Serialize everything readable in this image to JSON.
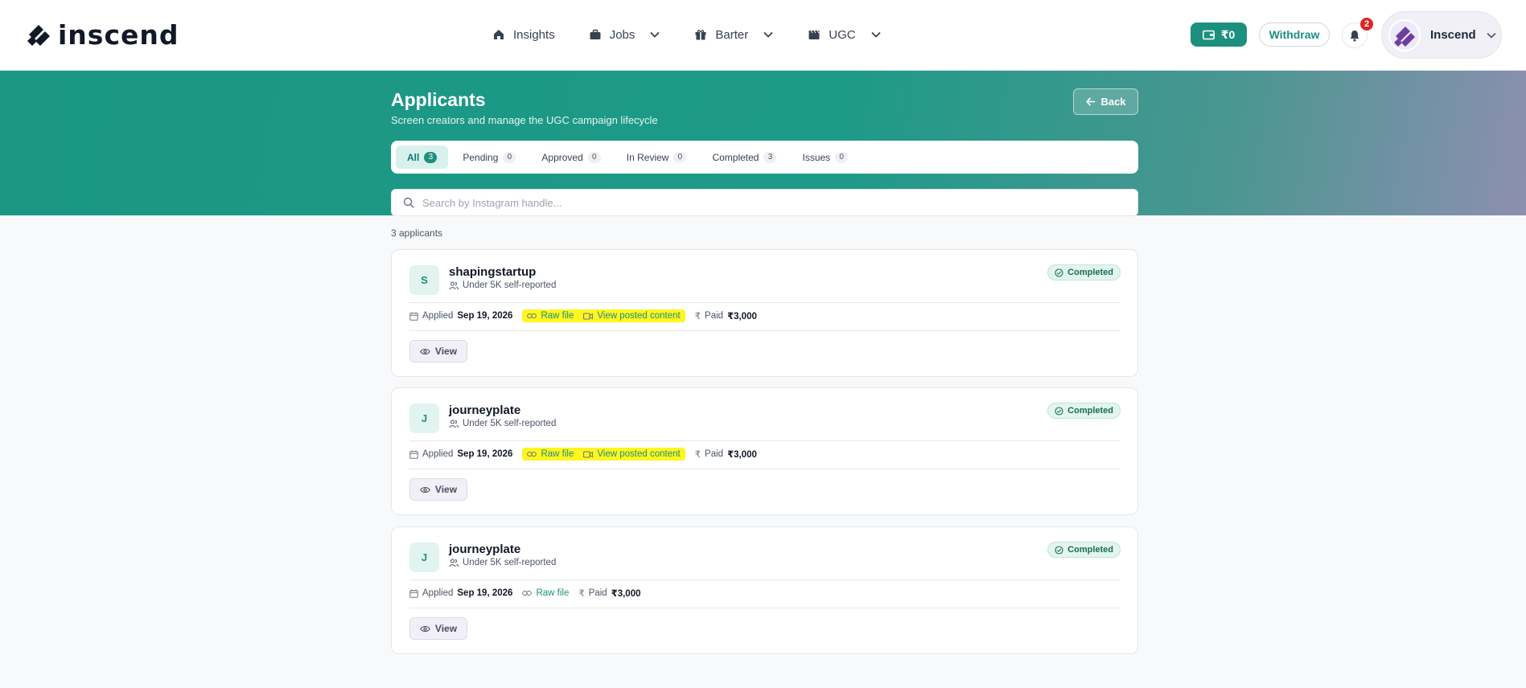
{
  "brand": {
    "name": "inscend"
  },
  "nav": {
    "items": [
      {
        "label": "Insights",
        "icon": "home-icon"
      },
      {
        "label": "Jobs",
        "icon": "briefcase-icon"
      },
      {
        "label": "Barter",
        "icon": "gift-icon"
      },
      {
        "label": "UGC",
        "icon": "clapperboard-icon"
      }
    ],
    "wallet_balance": "₹0",
    "withdraw_label": "Withdraw",
    "notification_count": "2",
    "profile_name": "Inscend"
  },
  "header": {
    "title": "Applicants",
    "subtitle": "Screen creators and manage the UGC campaign lifecycle",
    "back_label": "Back"
  },
  "tabs": [
    {
      "label": "All",
      "count": "3",
      "active": true
    },
    {
      "label": "Pending",
      "count": "0"
    },
    {
      "label": "Approved",
      "count": "0"
    },
    {
      "label": "In Review",
      "count": "0"
    },
    {
      "label": "Completed",
      "count": "3"
    },
    {
      "label": "Issues",
      "count": "0"
    }
  ],
  "search": {
    "placeholder": "Search by Instagram handle...",
    "value": ""
  },
  "results_count": "3 applicants",
  "labels": {
    "applied": "Applied",
    "paid": "Paid",
    "raw_file": "Raw file",
    "view_posted": "View posted content",
    "view": "View"
  },
  "applicants": [
    {
      "initial": "S",
      "handle": "shapingstartup",
      "followers": "Under 5K self-reported",
      "status": "Completed",
      "applied_date": "Sep 19, 2026",
      "paid": "₹3,000",
      "has_posted": true
    },
    {
      "initial": "J",
      "handle": "journeyplate",
      "followers": "Under 5K self-reported",
      "status": "Completed",
      "applied_date": "Sep 19, 2026",
      "paid": "₹3,000",
      "has_posted": true
    },
    {
      "initial": "J",
      "handle": "journeyplate",
      "followers": "Under 5K self-reported",
      "status": "Completed",
      "applied_date": "Sep 19, 2026",
      "paid": "₹3,000",
      "has_posted": false
    }
  ],
  "colors": {
    "accent": "#1d8f7f",
    "highlight": "#fdf61f",
    "badge": "#dc2626"
  }
}
